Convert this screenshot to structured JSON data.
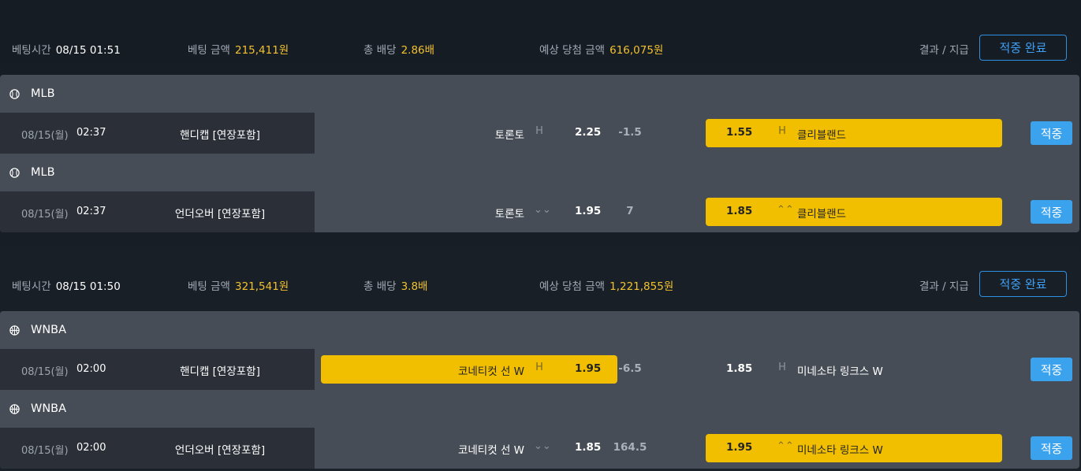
{
  "bets": [
    {
      "header": {
        "time_label": "베팅시간",
        "time_value": "08/15 01:51",
        "amount_label": "베팅 금액",
        "amount_value": "215,411원",
        "odds_label": "총 배당",
        "odds_value": "2.86배",
        "payout_label": "예상 당첨 금액",
        "payout_value": "616,075원",
        "result_label": "결과 / 지급",
        "result_button": "적중 완료"
      },
      "games": [
        {
          "league": "MLB",
          "league_icon": "baseball-icon",
          "date": "08/15(월)",
          "time": "02:37",
          "type": "핸디캡 [연장포함]",
          "home": "토론토",
          "home_icon": "H",
          "home_odds": "2.25",
          "line": "-1.5",
          "away_odds": "1.55",
          "away_icon": "H",
          "away": "클리블랜드",
          "selected": "away",
          "button": "적중"
        },
        {
          "league": "MLB",
          "league_icon": "baseball-icon",
          "date": "08/15(월)",
          "time": "02:37",
          "type": "언더오버 [연장포함]",
          "home": "토론토",
          "home_icon": "⌄⌄",
          "home_odds": "1.95",
          "line": "7",
          "away_odds": "1.85",
          "away_icon": "⌃⌃",
          "away": "클리블랜드",
          "selected": "away",
          "button": "적중"
        }
      ]
    },
    {
      "header": {
        "time_label": "베팅시간",
        "time_value": "08/15 01:50",
        "amount_label": "베팅 금액",
        "amount_value": "321,541원",
        "odds_label": "총 배당",
        "odds_value": "3.8배",
        "payout_label": "예상 당첨 금액",
        "payout_value": "1,221,855원",
        "result_label": "결과 / 지급",
        "result_button": "적중 완료"
      },
      "games": [
        {
          "league": "WNBA",
          "league_icon": "basketball-icon",
          "date": "08/15(월)",
          "time": "02:00",
          "type": "핸디캡 [연장포함]",
          "home": "코네티컷 선 W",
          "home_icon": "H",
          "home_odds": "1.95",
          "line": "-6.5",
          "away_odds": "1.85",
          "away_icon": "H",
          "away": "미네소타 링크스 W",
          "selected": "home",
          "button": "적중"
        },
        {
          "league": "WNBA",
          "league_icon": "basketball-icon",
          "date": "08/15(월)",
          "time": "02:00",
          "type": "언더오버 [연장포함]",
          "home": "코네티컷 선 W",
          "home_icon": "⌄⌄",
          "home_odds": "1.85",
          "line": "164.5",
          "away_odds": "1.95",
          "away_icon": "⌃⌃",
          "away": "미네소타 링크스 W",
          "selected": "away",
          "button": "적중"
        }
      ]
    }
  ],
  "colors": {
    "accent_yellow": "#f2bf00",
    "button_blue": "#3ba3ee",
    "value_yellow": "#f2c12e"
  }
}
